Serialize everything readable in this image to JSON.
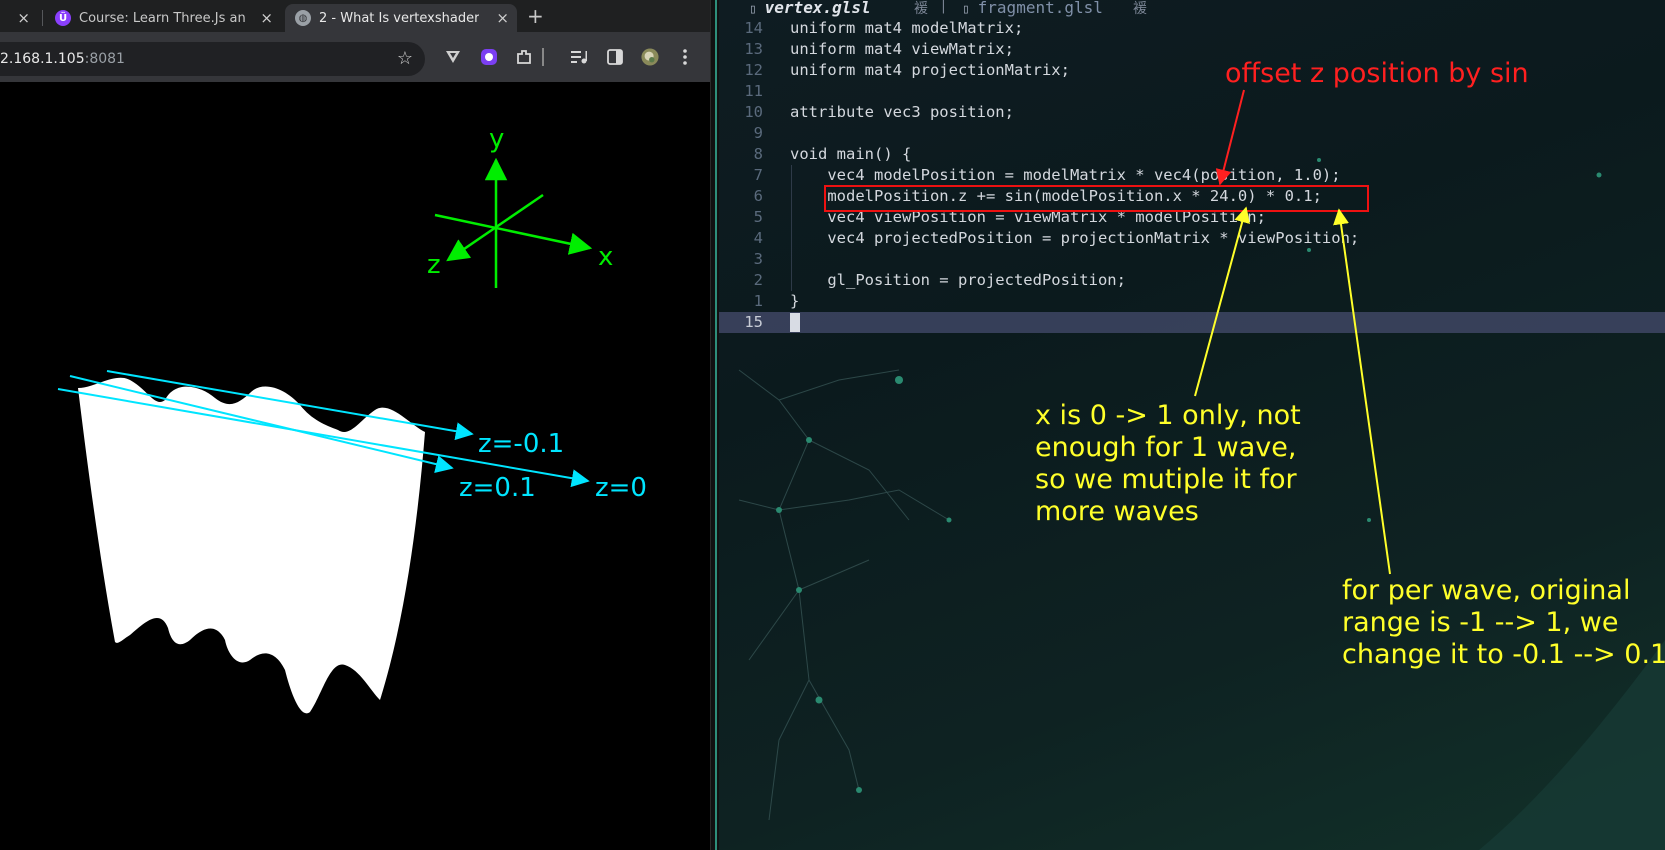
{
  "browser": {
    "tabs": [
      {
        "title": "",
        "close": "×",
        "icon": "tab-fragment-icon"
      },
      {
        "title": "Course: Learn Three.Js an",
        "close": "×",
        "icon": "udemy-icon"
      },
      {
        "title": "2 - What Is vertexshader ",
        "close": "×",
        "icon": "globe-icon",
        "active": true
      }
    ],
    "new_tab": "+",
    "url_host": "2.168.1.105",
    "url_port": ":8081",
    "toolbar_icons": [
      "star-icon",
      "vpn-icon",
      "proton-pass-icon",
      "extensions-icon",
      "media-control-icon",
      "side-panel-icon",
      "profile-avatar-icon",
      "menu-kebab-icon"
    ]
  },
  "scene": {
    "axis_labels": {
      "y": "y",
      "x": "x",
      "z": "z"
    },
    "z_labels": {
      "neg": "z=-0.1",
      "pos": "z=0.1",
      "zero": "z=0"
    },
    "colors": {
      "axes": "#00ee00",
      "arrows": "#00e5ff",
      "mesh": "#ffffff"
    }
  },
  "editor": {
    "tabs": [
      {
        "label": "vertex.glsl",
        "mark": "褑"
      },
      {
        "label": "fragment.glsl",
        "mark": "褑"
      }
    ],
    "lines": [
      {
        "num": "14",
        "text": "uniform mat4 modelMatrix;"
      },
      {
        "num": "13",
        "text": "uniform mat4 viewMatrix;"
      },
      {
        "num": "12",
        "text": "uniform mat4 projectionMatrix;"
      },
      {
        "num": "11",
        "text": ""
      },
      {
        "num": "10",
        "text": "attribute vec3 position;"
      },
      {
        "num": "9",
        "text": ""
      },
      {
        "num": "8",
        "text": "void main() {"
      },
      {
        "num": "7",
        "text": "    vec4 modelPosition = modelMatrix * vec4(position, 1.0);"
      },
      {
        "num": "6",
        "text": "    modelPosition.z += sin(modelPosition.x * 24.0) * 0.1;"
      },
      {
        "num": "5",
        "text": "    vec4 viewPosition = viewMatrix * modelPosition;"
      },
      {
        "num": "4",
        "text": "    vec4 projectedPosition = projectionMatrix * viewPosition;"
      },
      {
        "num": "3",
        "text": ""
      },
      {
        "num": "2",
        "text": "    gl_Position = projectedPosition;"
      },
      {
        "num": "1",
        "text": "}"
      },
      {
        "num": "15",
        "text": ""
      }
    ],
    "colors": {
      "highlight_box": "#ee1111",
      "annotation_red": "#ff2020",
      "annotation_yellow": "#ffff2a"
    }
  },
  "annotations": {
    "red": "offset z position by sin",
    "yellow_1": "x is 0 -> 1 only, not\nenough for 1 wave,\nso we mutiple it for\nmore waves",
    "yellow_2": "for per wave, original\nrange is -1 --> 1, we\nchange it to -0.1 --> 0.1"
  }
}
